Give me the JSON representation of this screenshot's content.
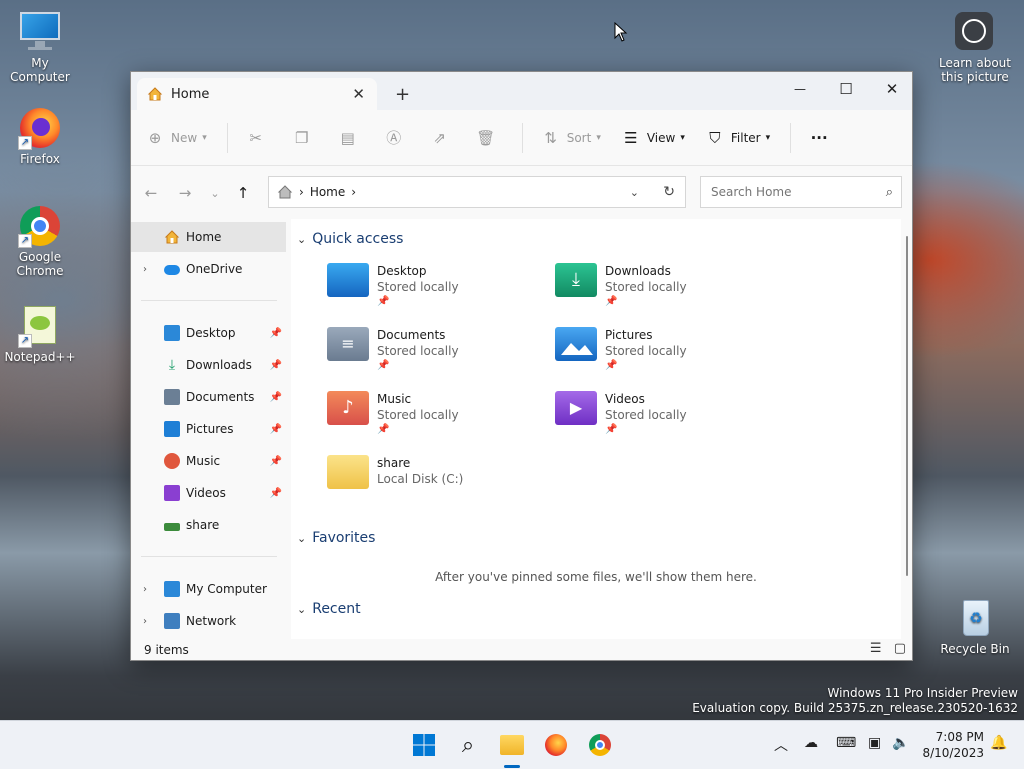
{
  "desktop": {
    "icons": [
      {
        "label": "My Computer"
      },
      {
        "label": "Firefox"
      },
      {
        "label": "Google Chrome"
      },
      {
        "label": "Notepad++"
      },
      {
        "label": "Recycle Bin"
      }
    ],
    "learn": {
      "label": "Learn about this picture"
    },
    "watermark": {
      "line1": "Windows 11 Pro Insider Preview",
      "line2": "Evaluation copy. Build 25375.zn_release.230520-1632"
    }
  },
  "explorer": {
    "tab": {
      "title": "Home",
      "close": "✕",
      "new_tab": "+"
    },
    "window_buttons": {
      "minimize": "—",
      "maximize": "☐",
      "close": "✕"
    },
    "toolbar": {
      "new": "New",
      "sort": "Sort",
      "view": "View",
      "filter": "Filter",
      "more": "···"
    },
    "address": {
      "crumb": "Home",
      "sep": "›"
    },
    "search": {
      "placeholder": "Search Home"
    },
    "nav_pane": {
      "home": "Home",
      "onedrive": "OneDrive",
      "pinned": [
        {
          "label": "Desktop",
          "color": "#2b88d8"
        },
        {
          "label": "Downloads",
          "color": "#1f9e6b"
        },
        {
          "label": "Documents",
          "color": "#6b7f95"
        },
        {
          "label": "Pictures",
          "color": "#1e7fd6"
        },
        {
          "label": "Music",
          "color": "#e0573d"
        },
        {
          "label": "Videos",
          "color": "#8a3fd1"
        },
        {
          "label": "share",
          "color": "#3c8b3c"
        }
      ],
      "my_computer": "My Computer",
      "network": "Network"
    },
    "sections": {
      "quick_access": "Quick access",
      "favorites": "Favorites",
      "recent": "Recent"
    },
    "quick_access_items": [
      {
        "name": "Desktop",
        "sub": "Stored locally",
        "color": "#1e88e5"
      },
      {
        "name": "Downloads",
        "sub": "Stored locally",
        "color": "#17a67a"
      },
      {
        "name": "Documents",
        "sub": "Stored locally",
        "color": "#7d8fa6"
      },
      {
        "name": "Pictures",
        "sub": "Stored locally",
        "color": "#1e7fd6"
      },
      {
        "name": "Music",
        "sub": "Stored locally",
        "color": "#e86a4b"
      },
      {
        "name": "Videos",
        "sub": "Stored locally",
        "color": "#8e4ad6"
      },
      {
        "name": "share",
        "sub": "Local Disk (C:)",
        "color": "#f2cf5b"
      }
    ],
    "favorites_empty": "After you've pinned some files, we'll show them here.",
    "status": {
      "count": "9 items"
    }
  },
  "taskbar": {
    "clock": {
      "time": "7:08 PM",
      "date": "8/10/2023"
    }
  }
}
